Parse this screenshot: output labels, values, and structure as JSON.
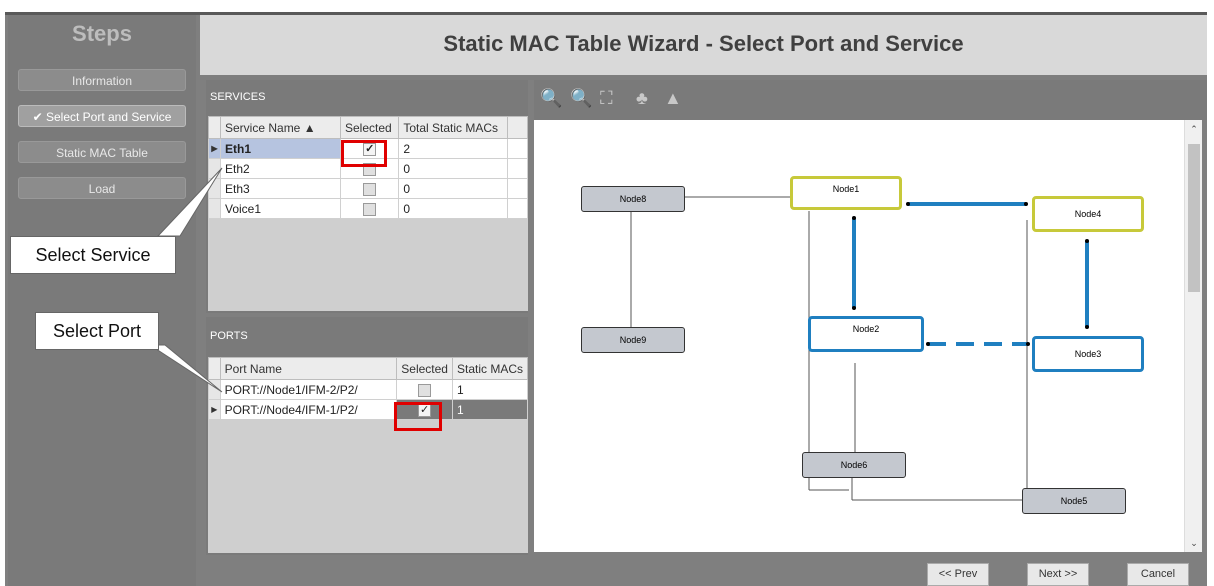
{
  "steps": {
    "title": "Steps",
    "items": [
      {
        "label": "Information"
      },
      {
        "label": "✔ Select Port and Service"
      },
      {
        "label": "Static MAC Table"
      },
      {
        "label": "Load"
      }
    ]
  },
  "header": {
    "title": "Static MAC Table Wizard - Select Port and Service"
  },
  "services": {
    "tab_label": "SERVICES",
    "columns": [
      "Service Name ▲",
      "Selected",
      "Total Static MACs"
    ],
    "rows": [
      {
        "name": "Eth1",
        "selected": true,
        "total": "2"
      },
      {
        "name": "Eth2",
        "selected": false,
        "total": "0"
      },
      {
        "name": "Eth3",
        "selected": false,
        "total": "0"
      },
      {
        "name": "Voice1",
        "selected": false,
        "total": "0"
      }
    ]
  },
  "ports": {
    "tab_label": "PORTS",
    "columns": [
      "Port Name",
      "Selected",
      "Static MACs"
    ],
    "rows": [
      {
        "name": "PORT://Node1/IFM-2/P2/",
        "selected": false,
        "macs": "1"
      },
      {
        "name": "PORT://Node4/IFM-1/P2/",
        "selected": true,
        "macs": "1"
      }
    ]
  },
  "callouts": {
    "service": "Select Service",
    "port": "Select Port"
  },
  "diagram": {
    "nodes": [
      "Node8",
      "Node1",
      "Node4",
      "Node9",
      "Node2",
      "Node3",
      "Node6",
      "Node5"
    ]
  },
  "footer": {
    "prev": "<< Prev",
    "next": "Next >>",
    "cancel": "Cancel"
  },
  "colors": {
    "accent_link": "#1f7fc0",
    "highlight_yellow": "#c7c93a",
    "selection_red": "#e00000"
  }
}
